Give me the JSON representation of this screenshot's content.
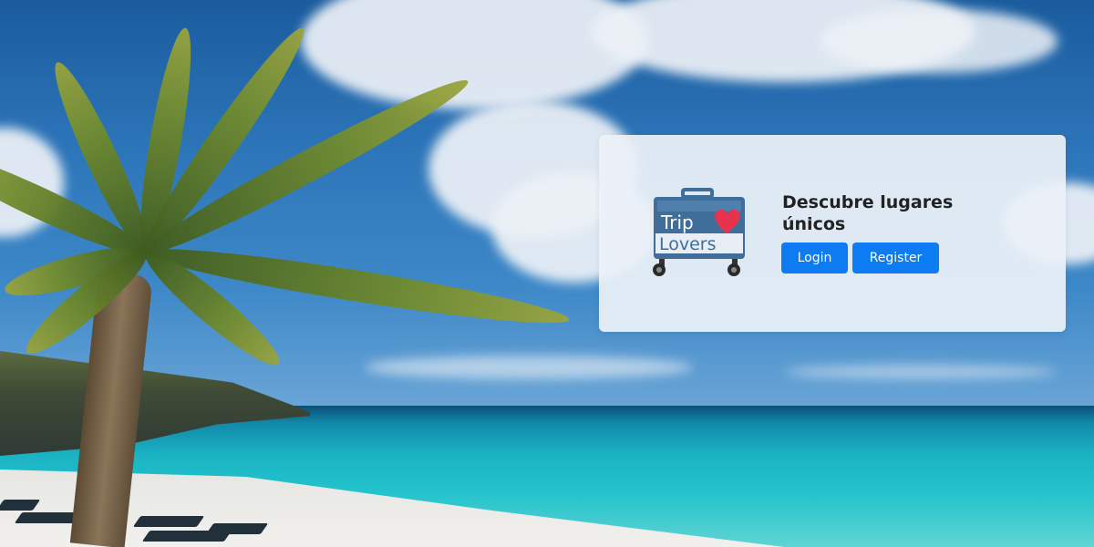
{
  "hero": {
    "background": "tropical-beach-palm-tree"
  },
  "card": {
    "logo": {
      "icon": "suitcase-heart-icon",
      "line1": "Trip",
      "line2": "Lovers"
    },
    "title": "Descubre lugares únicos",
    "login_label": "Login",
    "register_label": "Register"
  },
  "colors": {
    "primary_button": "#0d7bf2",
    "logo_blue": "#3f6e9a",
    "logo_heart": "#e8334f"
  }
}
